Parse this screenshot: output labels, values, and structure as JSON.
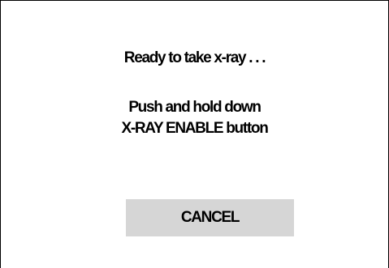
{
  "dialog": {
    "message_line1": "Ready to take x-ray . . .",
    "message_line2": "Push and hold down",
    "message_line3": "X-RAY ENABLE button",
    "cancel_label": "CANCEL"
  },
  "colors": {
    "background": "#ffffff",
    "border": "#000000",
    "button_bg": "#d6d6d6",
    "text": "#000000"
  }
}
